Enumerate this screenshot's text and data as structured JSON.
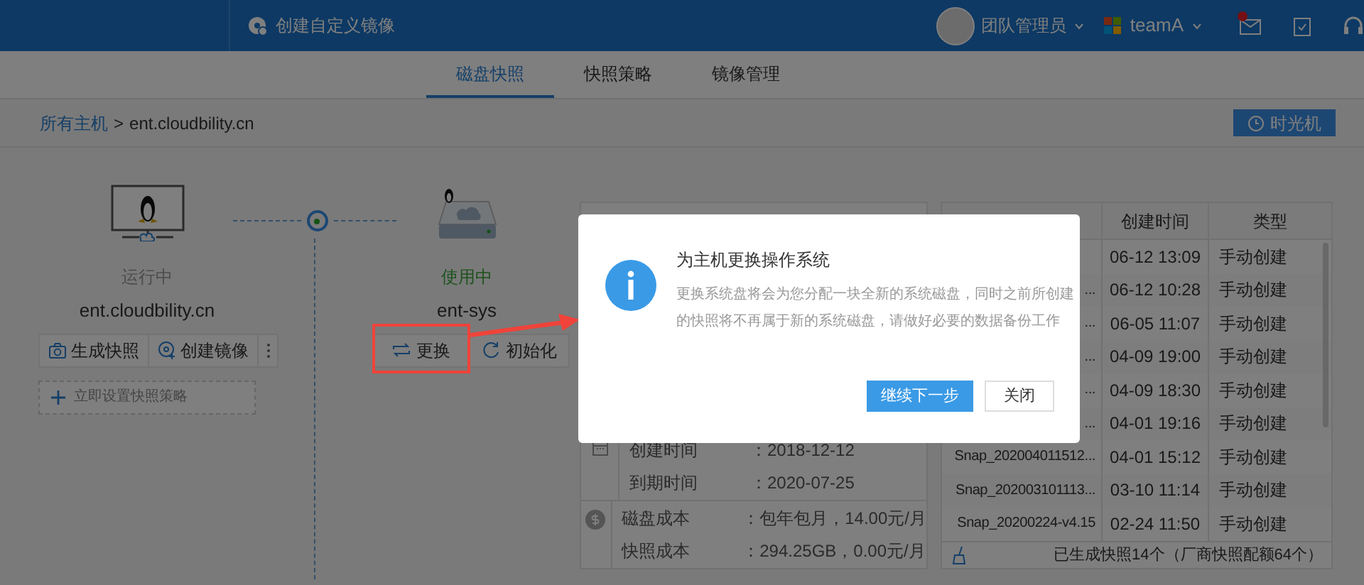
{
  "header": {
    "title": "创建自定义镜像",
    "user": "团队管理员",
    "team": "teamA",
    "unread": true
  },
  "tabs": [
    {
      "label": "磁盘快照",
      "selected": true
    },
    {
      "label": "快照策略",
      "selected": false
    },
    {
      "label": "镜像管理",
      "selected": false
    }
  ],
  "breadcrumb": {
    "parent": "所有主机",
    "separator": ">",
    "current": "ent.cloudbility.cn"
  },
  "time_machine_button": "时光机",
  "host": {
    "kind": "running",
    "status": "运行中",
    "name": "ent.cloudbility.cn",
    "actions": [
      {
        "kind": "snapshot",
        "label": "生成快照"
      },
      {
        "kind": "image",
        "label": "创建镜像"
      }
    ],
    "policy_link": "立即设置快照策略"
  },
  "disk": {
    "kind": "in_use",
    "status": "使用中",
    "name": "ent-sys",
    "actions": [
      {
        "kind": "replace",
        "label": "更换",
        "highlighted": true
      },
      {
        "kind": "reset",
        "label": "初始化",
        "highlighted": false
      }
    ]
  },
  "info": [
    {
      "kind": "date",
      "rows": [
        {
          "label": "创建时间",
          "value": "：2018-12-12"
        },
        {
          "label": "到期时间",
          "value": "：2020-07-25"
        }
      ]
    },
    {
      "kind": "cost",
      "rows": [
        {
          "label": "磁盘成本",
          "value": "：包年包月，14.00元/月"
        },
        {
          "label": "快照成本",
          "value": "：294.25GB，0.00元/月"
        }
      ]
    }
  ],
  "snapshots": {
    "columns": [
      "创建时间",
      "类型"
    ],
    "rows": [
      {
        "time": "06-12 13:09",
        "type": "手动创建"
      },
      {
        "name": "...",
        "time": "06-12 10:28",
        "type": "手动创建"
      },
      {
        "name": "...",
        "time": "06-05 11:07",
        "type": "手动创建"
      },
      {
        "name": "...",
        "time": "04-09 19:00",
        "type": "手动创建"
      },
      {
        "name": "...",
        "time": "04-09 18:30",
        "type": "手动创建"
      },
      {
        "name": "...",
        "time": "04-01 19:16",
        "type": "手动创建"
      },
      {
        "name": "Snap_202004011512...",
        "time": "04-01 15:12",
        "type": "手动创建"
      },
      {
        "name": "Snap_202003101113...",
        "time": "03-10 11:14",
        "type": "手动创建"
      },
      {
        "name": "Snap_20200224-v4.15",
        "time": "02-24 11:50",
        "type": "手动创建"
      }
    ],
    "footer": "已生成快照14个（厂商快照配额64个）"
  },
  "dialog": {
    "title": "为主机更换操作系统",
    "message": "更换系统盘将会为您分配一块全新的系统磁盘，同时之前所创建的快照将不再属于新的系统磁盘，请做好必要的数据备份工作",
    "buttons": [
      {
        "label": "继续下一步",
        "primary": true
      },
      {
        "label": "关闭",
        "primary": false
      }
    ]
  }
}
